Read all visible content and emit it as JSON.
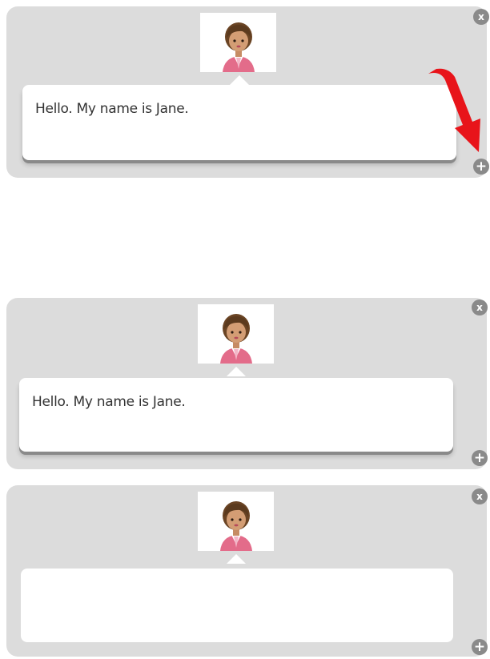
{
  "panels": [
    {
      "bubble_text": "Hello.  My name is Jane.",
      "close_glyph": "x",
      "add_glyph": "+",
      "avatar_icon": "person-avatar-icon"
    },
    {
      "bubble_text": "Hello.  My name is Jane.",
      "close_glyph": "x",
      "add_glyph": "+",
      "avatar_icon": "person-avatar-icon"
    },
    {
      "bubble_text": "",
      "close_glyph": "x",
      "add_glyph": "+",
      "avatar_icon": "person-avatar-icon"
    }
  ],
  "annotation": {
    "arrow_color": "#e8141a",
    "points_to": "add-button"
  },
  "colors": {
    "panel_bg": "#dcdcdc",
    "button_bg": "#8a8a8a",
    "bubble_bg": "#ffffff"
  }
}
